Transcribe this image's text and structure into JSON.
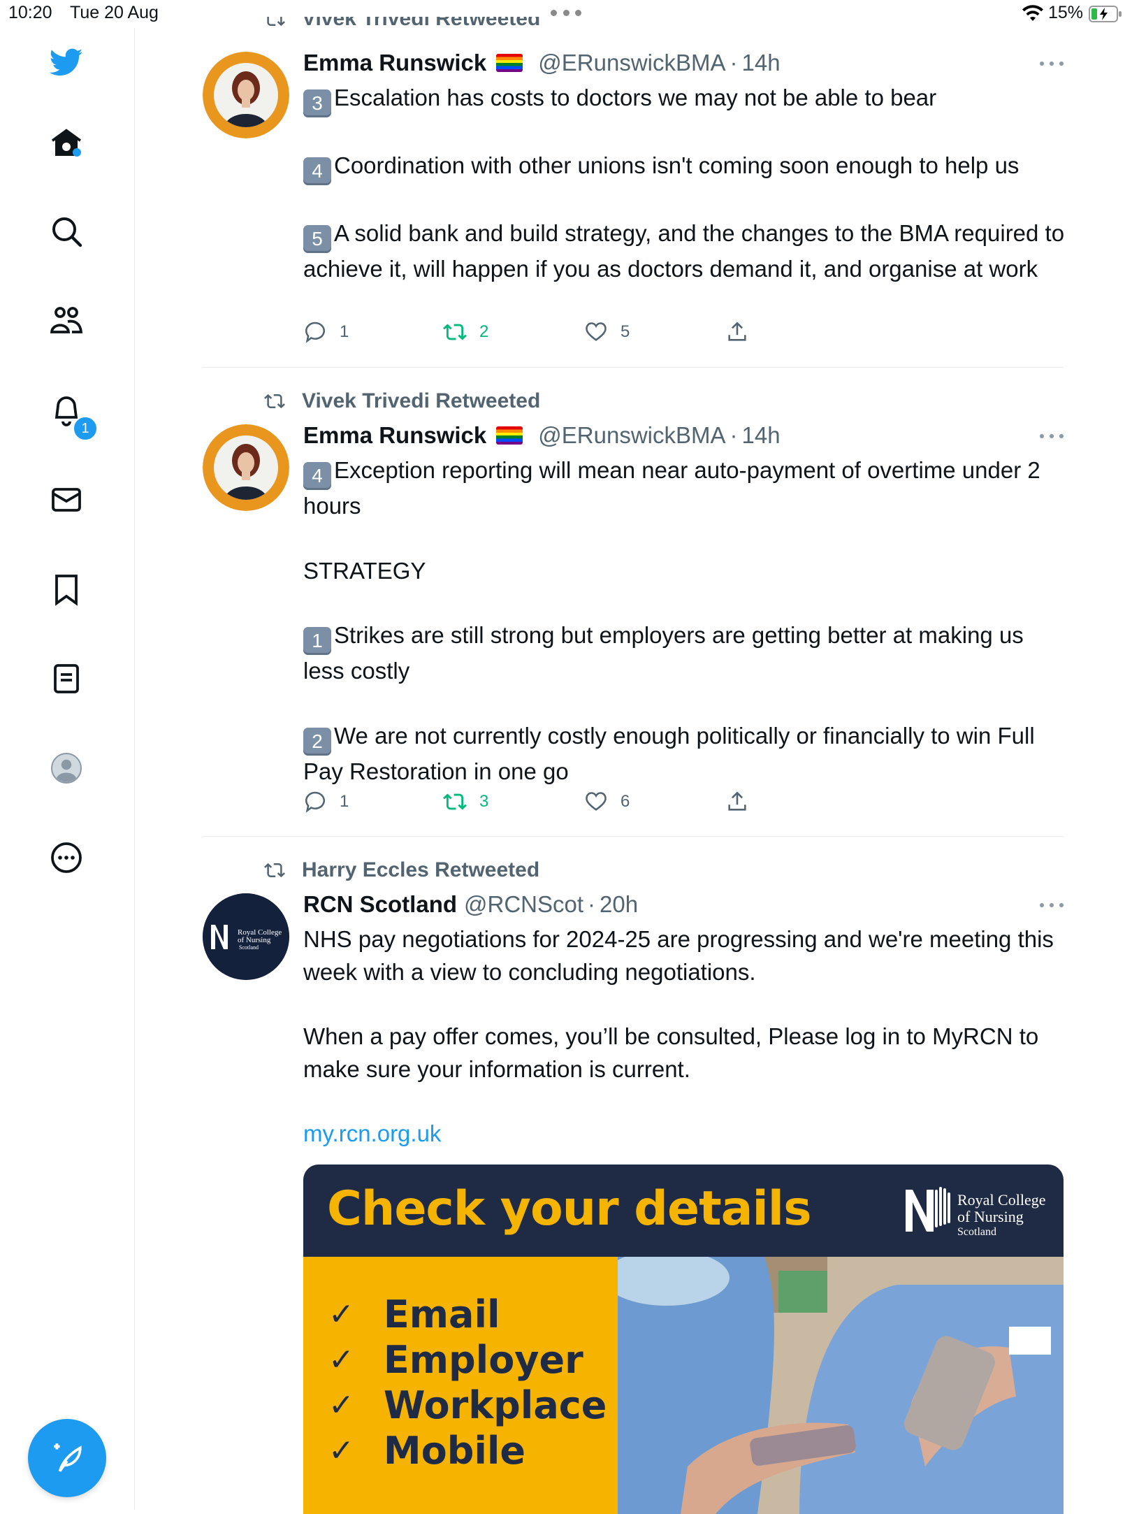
{
  "status_bar": {
    "time": "10:20",
    "date": "Tue 20 Aug",
    "battery": "15%"
  },
  "sidebar": {
    "items": [
      {
        "name": "home",
        "label": "Home"
      },
      {
        "name": "explore",
        "label": "Explore"
      },
      {
        "name": "communities",
        "label": "Communities"
      },
      {
        "name": "notifications",
        "label": "Notifications",
        "badge": "1"
      },
      {
        "name": "messages",
        "label": "Messages"
      },
      {
        "name": "bookmarks",
        "label": "Bookmarks"
      },
      {
        "name": "lists",
        "label": "Lists"
      },
      {
        "name": "profile",
        "label": "Profile"
      },
      {
        "name": "more",
        "label": "More"
      }
    ],
    "accent": "#1d9bf0"
  },
  "feed": {
    "top_retweet_partial": "Vivek Trivedi Retweeted",
    "tweets": [
      {
        "retweeted_by": "",
        "name": "Emma Runswick",
        "handle": "@ERunswickBMA",
        "time": "14h",
        "paragraphs": [
          {
            "key": "3",
            "text": "Escalation has costs to doctors we may not be able to bear"
          },
          {
            "key": "4",
            "text": "Coordination with other unions isn't coming soon enough to help us"
          },
          {
            "key": "5",
            "text": "A solid bank and build strategy, and the changes to the BMA required to achieve it, will happen if you as doctors demand it, and organise at work"
          }
        ],
        "replies": "1",
        "retweets": "2",
        "likes": "5"
      },
      {
        "retweeted_by": "Vivek Trivedi Retweeted",
        "name": "Emma Runswick",
        "handle": "@ERunswickBMA",
        "time": "14h",
        "paragraphs": [
          {
            "key": "4",
            "text": "Exception reporting will mean near auto-payment of overtime under 2 hours"
          },
          {
            "key": "",
            "text": "STRATEGY"
          },
          {
            "key": "1",
            "text": "Strikes are still strong but employers are getting better at making us less costly"
          },
          {
            "key": "2",
            "text": "We are not currently costly enough politically or financially to win Full Pay Restoration in one go"
          }
        ],
        "replies": "1",
        "retweets": "3",
        "likes": "6"
      },
      {
        "retweeted_by": "Harry Eccles Retweeted",
        "name": "RCN Scotland",
        "handle": "@RCNScot",
        "time": "20h",
        "paragraphs": [
          {
            "text": "NHS pay negotiations for 2024-25 are progressing and we're meeting this week with a view to concluding negotiations."
          },
          {
            "text": "When a pay offer comes, you’ll be consulted, Please log in to MyRCN to make sure your information is current."
          }
        ],
        "link": "my.rcn.org.uk",
        "avatar_text": [
          "Royal College",
          "of Nursing",
          "Scotland"
        ],
        "media": {
          "title": "Check your details",
          "logo_lines": [
            "Royal College",
            "of Nursing",
            "Scotland"
          ],
          "checklist": [
            "Email",
            "Employer",
            "Workplace",
            "Mobile"
          ],
          "check_glyph": "✓"
        }
      }
    ]
  }
}
